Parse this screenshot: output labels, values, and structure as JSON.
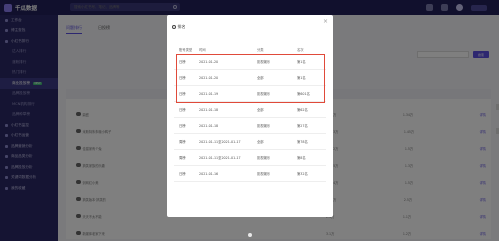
{
  "app": {
    "title": "千瓜数据"
  },
  "search": {
    "placeholder": "搜索小红书号、笔记、品牌等"
  },
  "sidebar": {
    "items": [
      {
        "label": "工作台",
        "sub": false
      },
      {
        "label": "博主查找",
        "sub": false
      },
      {
        "label": "小红书排行",
        "sub": false
      },
      {
        "label": "达人排行",
        "sub": true
      },
      {
        "label": "涨粉排行",
        "sub": true
      },
      {
        "label": "热门排行",
        "sub": true
      },
      {
        "label": "商业投放榜",
        "sub": true,
        "badge": "NEW",
        "active": true
      },
      {
        "label": "品牌投放榜",
        "sub": true
      },
      {
        "label": "MCN机构排行",
        "sub": true
      },
      {
        "label": "品牌种草榜",
        "sub": true
      },
      {
        "label": "小红书监控",
        "sub": false
      },
      {
        "label": "小红书运营",
        "sub": false
      },
      {
        "label": "品牌营销分析",
        "sub": false
      },
      {
        "label": "商品品类分析",
        "sub": false
      },
      {
        "label": "品牌投放分析",
        "sub": false
      },
      {
        "label": "关键词数据分析",
        "sub": false
      },
      {
        "label": "我的收藏",
        "sub": false
      }
    ]
  },
  "tabs": [
    {
      "label": "问题排行",
      "active": true
    },
    {
      "label": "日投榜",
      "active": false
    }
  ],
  "background": {
    "button_label": "搜索",
    "rows": [
      {
        "name": "鼎盛",
        "cells": [
          "50.5万",
          "1.34万",
          "详情"
        ]
      },
      {
        "name": "米斯特朱朱哦小鸭子",
        "cells": [
          "270.3万",
          "1.45万",
          "详情"
        ]
      },
      {
        "name": "佳猫家有个兔",
        "cells": [
          "121.2万",
          "1.5万",
          "详情"
        ]
      },
      {
        "name": "搞笑家族的乐趣",
        "cells": [
          "181.5万",
          "1.3万",
          "详情"
        ]
      },
      {
        "name": "剑网红小美",
        "cells": [
          "441.4万",
          "1.5万",
          "详情"
        ]
      },
      {
        "name": "搞笑版本·搞笑的",
        "cells": [
          "33.6万",
          "2.5万",
          "详情"
        ]
      },
      {
        "name": "天天不太不能",
        "cells": [
          "2.4万",
          "1.1万",
          "详情"
        ]
      },
      {
        "name": "新媒体老家下来",
        "cells": [
          "3.1万",
          "1.2万",
          "详情"
        ]
      }
    ]
  },
  "modal": {
    "title": "排名",
    "close_icon": "close-icon",
    "columns": [
      "账号类型",
      "时间",
      "分类",
      "名次"
    ],
    "rows": [
      {
        "type": "日榜",
        "date": "2021-01-20",
        "category": "影视娱乐",
        "rank": "第1名"
      },
      {
        "type": "日榜",
        "date": "2021-01-20",
        "category": "全部",
        "rank": "第1名"
      },
      {
        "type": "日榜",
        "date": "2021-01-19",
        "category": "影视娱乐",
        "rank": "第601名"
      },
      {
        "type": "日榜",
        "date": "2021-01-18",
        "category": "全部",
        "rank": "第62名"
      },
      {
        "type": "日榜",
        "date": "2021-01-18",
        "category": "影视娱乐",
        "rank": "第27名"
      },
      {
        "type": "周榜",
        "date": "2021-01-11至2021-01-17",
        "category": "全部",
        "rank": "第78名"
      },
      {
        "type": "周榜",
        "date": "2021-01-11至2021-01-17",
        "category": "影视娱乐",
        "rank": "第8名"
      },
      {
        "type": "日榜",
        "date": "2021-01-16",
        "category": "影视娱乐",
        "rank": "第32名"
      }
    ],
    "highlight_color": "#e04a3a"
  },
  "colors": {
    "header": "#22205a",
    "sidebar": "#2b2966",
    "accent": "#5b4fe0"
  }
}
